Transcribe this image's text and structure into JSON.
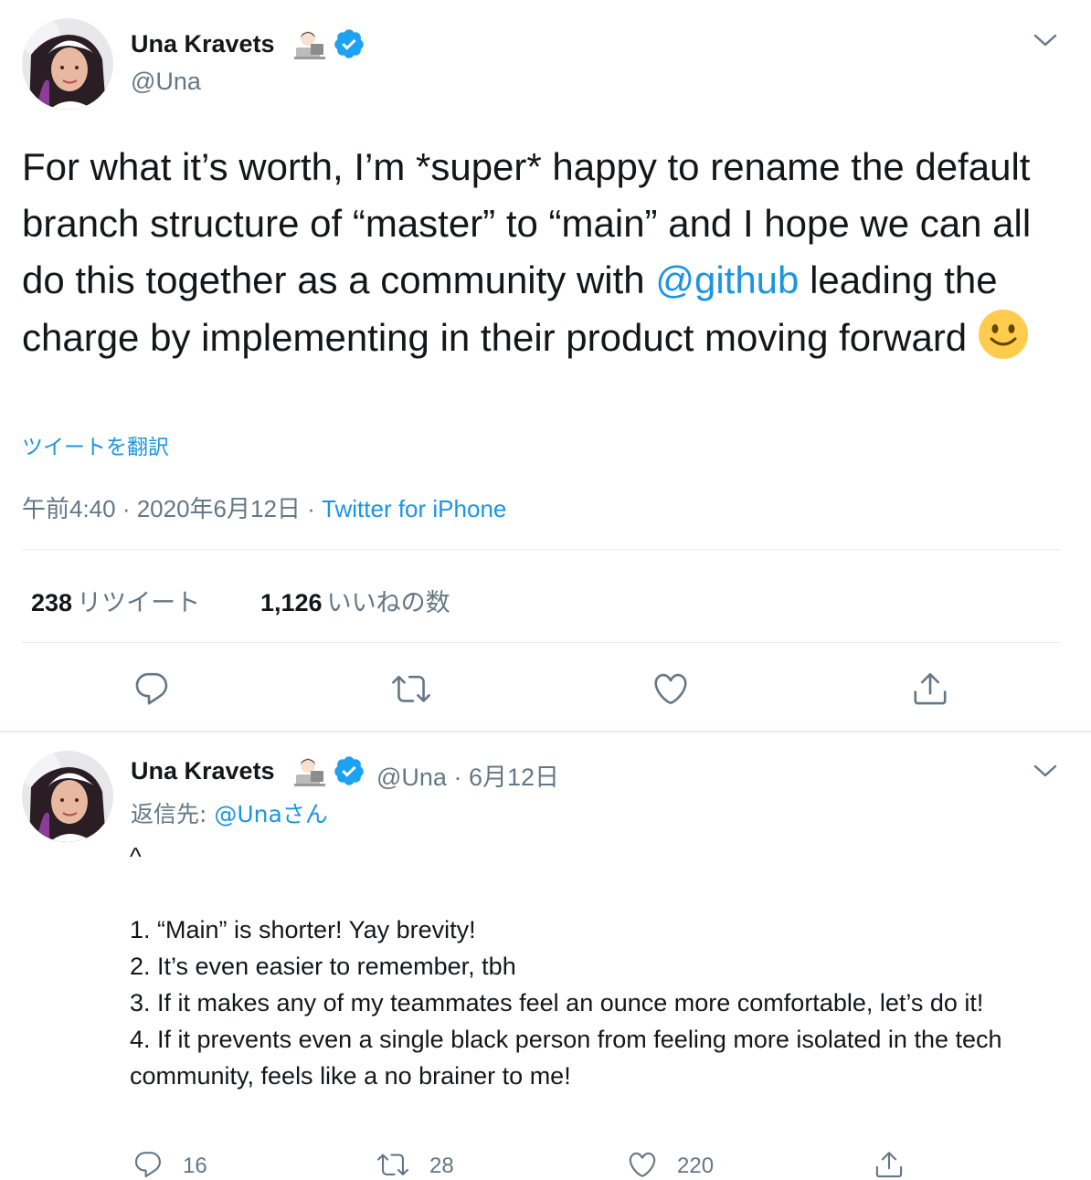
{
  "tweet": {
    "author_name": "Una Kravets",
    "author_emoji": "technologist-emoji",
    "author_handle": "@Una",
    "text_before_link": "For what it’s worth, I’m *super* happy to rename the default branch structure of “master” to “main” and I hope we can all do this together as a community with ",
    "mention": "@github",
    "text_after_link": " leading the charge by implementing in their product moving forward",
    "emoji": "slightly-smiling-face",
    "translate_label": "ツイートを翻訳",
    "timestamp": "午前4:40 · 2020年6月12日",
    "source_sep": " · ",
    "source": "Twitter for iPhone",
    "retweets_count": "238",
    "retweets_label": "リツイート",
    "likes_count": "1,126",
    "likes_label": "いいねの数"
  },
  "reply": {
    "author_name": "Una Kravets",
    "author_handle": "@Una",
    "date": " · 6月12日",
    "replying_label": "返信先: ",
    "replying_to": "@Unaさん",
    "text": "^\n\n1. “Main” is shorter! Yay brevity!\n2. It’s even easier to remember, tbh\n3. If it makes any of my teammates feel an ounce more comfortable, let’s do it!\n4. If it prevents even a single black person from feeling more isolated in the tech community, feels like a no brainer to me!",
    "reply_count": "16",
    "retweet_count": "28",
    "like_count": "220"
  },
  "colors": {
    "link": "#1b95e0",
    "secondary": "#657786",
    "verified": "#1da1f2",
    "divider": "#e6ecf0"
  }
}
